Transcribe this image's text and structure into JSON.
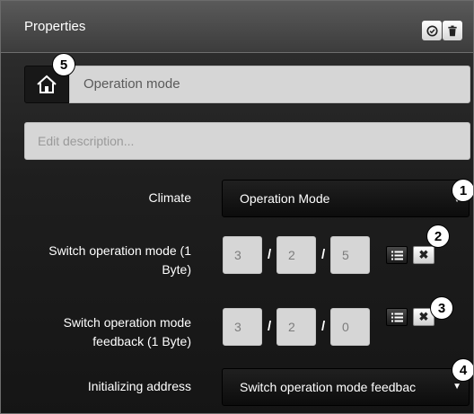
{
  "title": "Properties",
  "titlebar_icons": [
    "check-circle-icon",
    "trash-icon"
  ],
  "name_field": {
    "value": "Operation mode"
  },
  "description_field": {
    "placeholder": "Edit description..."
  },
  "climate": {
    "label": "Climate",
    "selected": "Operation Mode"
  },
  "switch_mode": {
    "label_line1": "Switch operation mode (1",
    "label_line2": "Byte)",
    "address": [
      "3",
      "2",
      "5"
    ]
  },
  "switch_feedback": {
    "label_line1": "Switch operation mode",
    "label_line2": "feedback (1 Byte)",
    "address": [
      "3",
      "2",
      "0"
    ]
  },
  "init_address": {
    "label": "Initializing address",
    "selected": "Switch operation mode feedbac"
  },
  "slash": "/",
  "delete_glyph": "✖",
  "callouts": [
    "1",
    "2",
    "3",
    "4",
    "5"
  ]
}
